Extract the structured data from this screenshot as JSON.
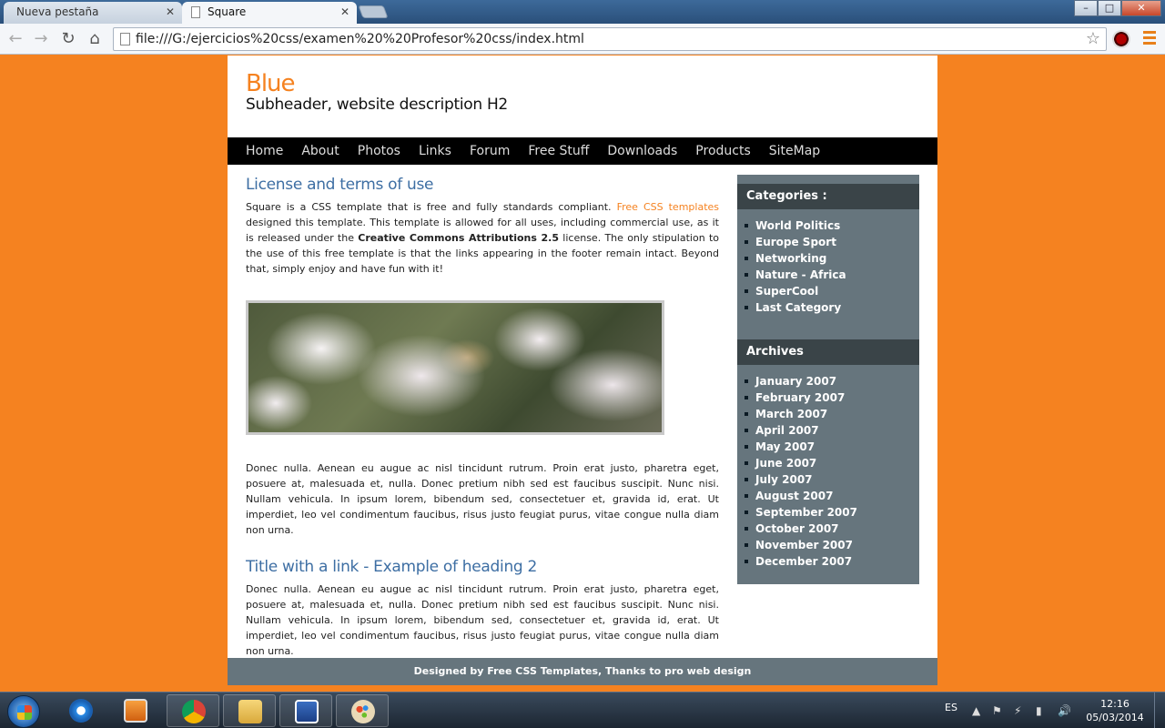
{
  "browser": {
    "tabs": [
      {
        "label": "Nueva pestaña",
        "active": false
      },
      {
        "label": "Square",
        "active": true
      }
    ],
    "url": "file:///G:/ejercicios%20css/examen%20%20Profesor%20css/index.html",
    "window_buttons": {
      "minimize": "–",
      "maximize": "□",
      "close": "✕"
    }
  },
  "site": {
    "title": "Blue",
    "subtitle": "Subheader, website description H2",
    "menu": [
      "Home",
      "About",
      "Photos",
      "Links",
      "Forum",
      "Free Stuff",
      "Downloads",
      "Products",
      "SiteMap"
    ]
  },
  "main": {
    "heading1": "License and terms of use",
    "p1_a": "Square is a CSS template that is free and fully standards compliant. ",
    "p1_link": "Free CSS templates",
    "p1_b": " designed this template. This template is allowed for all uses, including commercial use, as it is released under the ",
    "p1_bold": "Creative Commons Attributions 2.5",
    "p1_c": " license. The only stipulation to the use of this free template is that the links appearing in the footer remain intact. Beyond that, simply enjoy and have fun with it!",
    "p2": "Donec nulla. Aenean eu augue ac nisl tincidunt rutrum. Proin erat justo, pharetra eget, posuere at, malesuada et, nulla. Donec pretium nibh sed est faucibus suscipit. Nunc nisi. Nullam vehicula. In ipsum lorem, bibendum sed, consectetuer et, gravida id, erat. Ut imperdiet, leo vel condimentum faucibus, risus justo feugiat purus, vitae congue nulla diam non urna.",
    "heading2": "Title with a link - Example of heading 2",
    "p3": "Donec nulla. Aenean eu augue ac nisl tincidunt rutrum. Proin erat justo, pharetra eget, posuere at, malesuada et, nulla. Donec pretium nibh sed est faucibus suscipit. Nunc nisi. Nullam vehicula. In ipsum lorem, bibendum sed, consectetuer et, gravida id, erat. Ut imperdiet, leo vel condimentum faucibus, risus justo feugiat purus, vitae congue nulla diam non urna."
  },
  "sidebar": {
    "categories_title": "Categories :",
    "categories": [
      "World Politics",
      "Europe Sport",
      "Networking",
      "Nature - Africa",
      "SuperCool",
      "Last Category"
    ],
    "archives_title": "Archives",
    "archives": [
      "January 2007",
      "February 2007",
      "March 2007",
      "April 2007",
      "May 2007",
      "June 2007",
      "July 2007",
      "August 2007",
      "September 2007",
      "October 2007",
      "November 2007",
      "December 2007"
    ]
  },
  "footer": {
    "text": "Designed by Free CSS Templates, Thanks to pro web design"
  },
  "taskbar": {
    "language": "ES",
    "time": "12:16",
    "date": "05/03/2014",
    "apps": [
      "internet-explorer",
      "media-player",
      "chrome",
      "file-explorer",
      "word",
      "paint"
    ]
  },
  "colors": {
    "page_bg": "#f58220",
    "heading": "#3d6ea3",
    "sidebar": "#66757d",
    "sidebar_head": "#3a4448"
  }
}
